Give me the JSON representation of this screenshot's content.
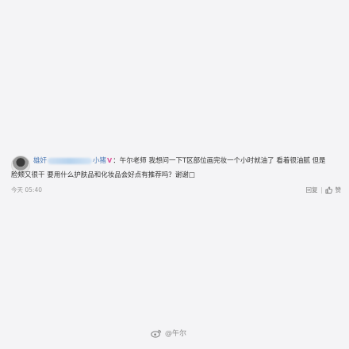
{
  "comment": {
    "author_prefix": "雄奸",
    "author_suffix": "小猪",
    "vip_mark": "V",
    "colon": "：",
    "text_line1": "午尔老师 我想问一下T区部位画完妆一个小时就油了 看着很油腻 但是",
    "text_line2": "脸颊又很干 要用什么护肤品和化妆品会好点有推荐吗？谢谢□",
    "time": "今天 05:40",
    "reply_label": "回复",
    "like_label": "赞"
  },
  "watermark": {
    "text": "@午尔"
  }
}
